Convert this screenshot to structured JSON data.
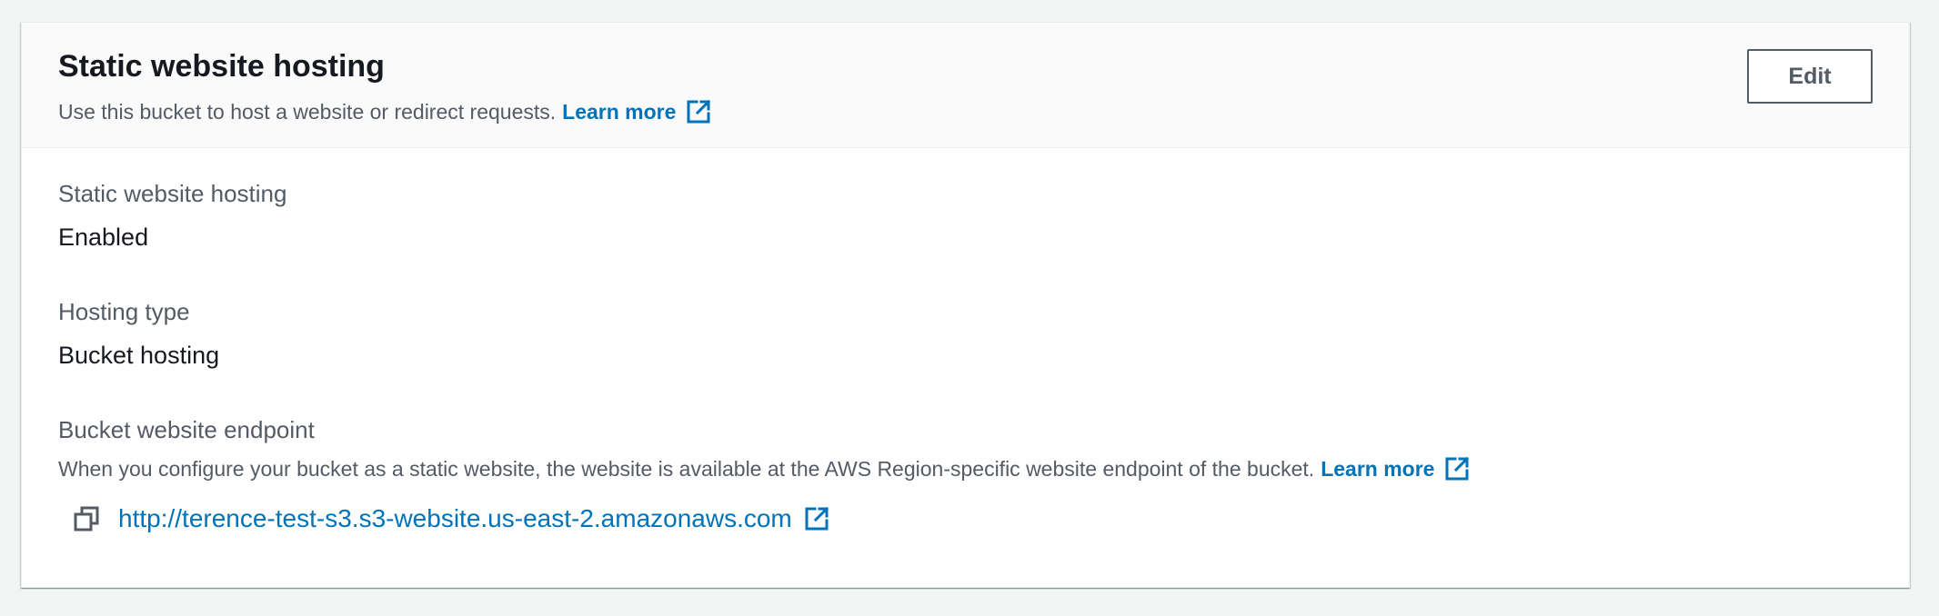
{
  "header": {
    "title": "Static website hosting",
    "description": "Use this bucket to host a website or redirect requests.",
    "learn_more": "Learn more",
    "edit_label": "Edit"
  },
  "fields": {
    "hosting": {
      "label": "Static website hosting",
      "value": "Enabled"
    },
    "hosting_type": {
      "label": "Hosting type",
      "value": "Bucket hosting"
    },
    "endpoint": {
      "label": "Bucket website endpoint",
      "description": "When you configure your bucket as a static website, the website is available at the AWS Region-specific website endpoint of the bucket.",
      "learn_more": "Learn more",
      "url": "http://terence-test-s3.s3-website.us-east-2.amazonaws.com"
    }
  },
  "icons": {
    "external_link": "external-link-icon",
    "copy": "copy-icon"
  },
  "colors": {
    "link": "#0073bb",
    "text_primary": "#16191f",
    "text_secondary": "#545b64",
    "page_background": "#f2f3f3",
    "header_background": "#fafafa"
  }
}
